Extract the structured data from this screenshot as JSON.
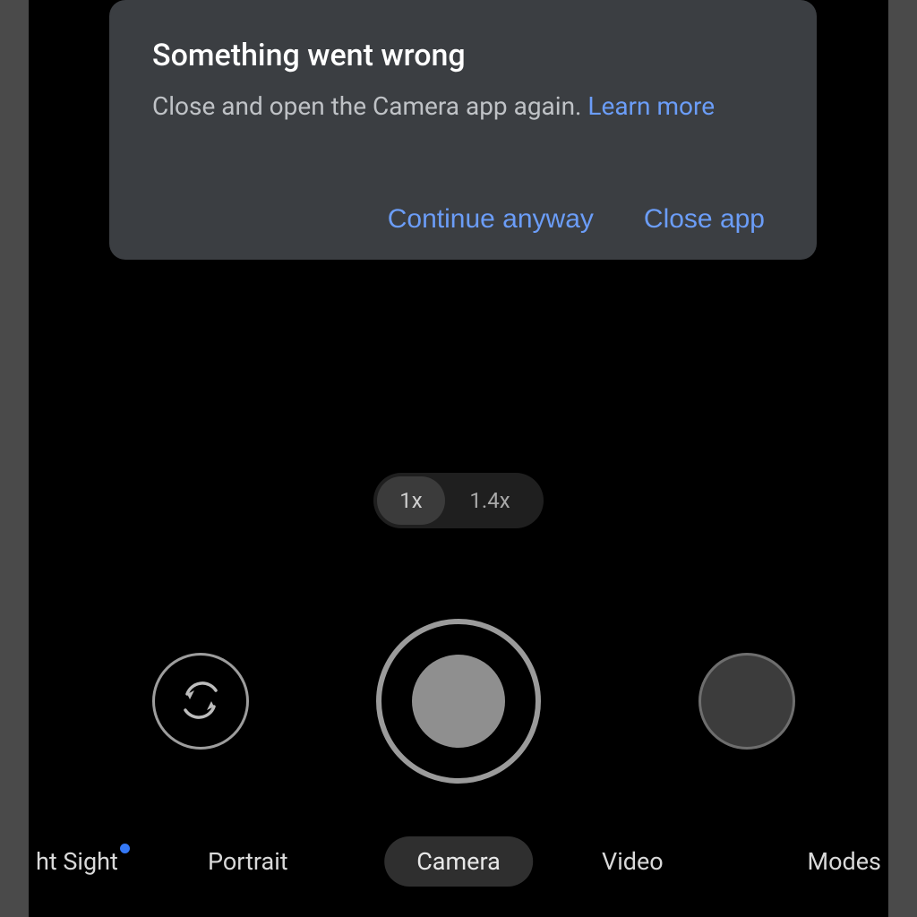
{
  "dialog": {
    "title": "Something went wrong",
    "body_text": "Close and open the Camera app again. ",
    "learn_more": "Learn more",
    "continue_label": "Continue anyway",
    "close_label": "Close app"
  },
  "zoom": {
    "opt1": "1x",
    "opt2": "1.4x"
  },
  "modes": {
    "night": "ht Sight",
    "portrait": "Portrait",
    "camera": "Camera",
    "video": "Video",
    "modes": "Modes"
  }
}
